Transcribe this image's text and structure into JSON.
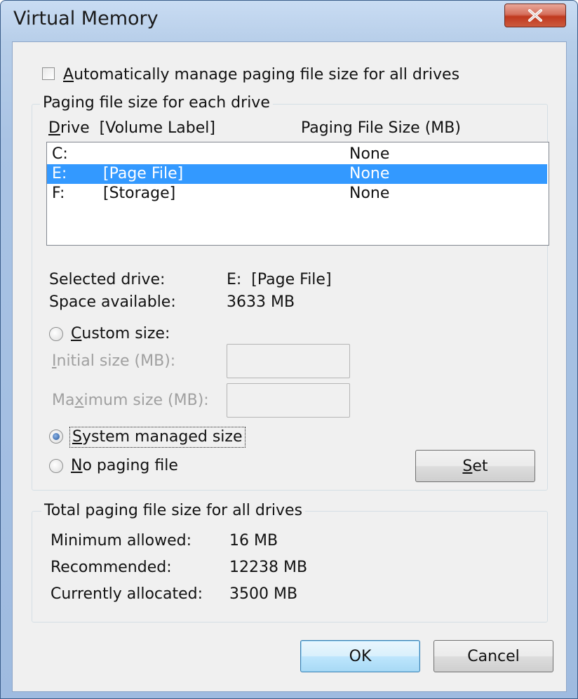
{
  "window": {
    "title": "Virtual Memory"
  },
  "auto_manage": {
    "label_pre": "",
    "label_mnemonic": "A",
    "label_post": "utomatically manage paging file size for all drives",
    "checked": false
  },
  "paging_group": {
    "label": "Paging file size for each drive",
    "col_drive_mnemonic": "D",
    "col_drive_rest": "rive  [Volume Label]",
    "col_size": "Paging File Size (MB)",
    "rows": [
      {
        "drive": "C:",
        "label": "",
        "size": "None",
        "selected": false
      },
      {
        "drive": "E:",
        "label": "[Page File]",
        "size": "None",
        "selected": true
      },
      {
        "drive": "F:",
        "label": "[Storage]",
        "size": "None",
        "selected": false
      }
    ],
    "selected_drive_label": "Selected drive:",
    "selected_drive_value": "E:  [Page File]",
    "space_available_label": "Space available:",
    "space_available_value": "3633 MB",
    "custom_size": {
      "mnemonic": "C",
      "rest": "ustom size:",
      "selected": false
    },
    "initial_size": {
      "mnemonic": "I",
      "rest": "nitial size (MB):",
      "value": ""
    },
    "maximum_size": {
      "pre": "Ma",
      "mnemonic": "x",
      "rest": "imum size (MB):",
      "value": ""
    },
    "system_managed": {
      "pre": "",
      "mnemonic": "S",
      "rest": "ystem managed size",
      "selected": true
    },
    "no_paging": {
      "mnemonic": "N",
      "rest": "o paging file",
      "selected": false
    },
    "set_button": {
      "mnemonic": "S",
      "rest": "et"
    }
  },
  "totals_group": {
    "label": "Total paging file size for all drives",
    "minimum_label": "Minimum allowed:",
    "minimum_value": "16 MB",
    "recommended_label": "Recommended:",
    "recommended_value": "12238 MB",
    "allocated_label": "Currently allocated:",
    "allocated_value": "3500 MB"
  },
  "footer": {
    "ok_label": "OK",
    "cancel_label": "Cancel"
  },
  "icons": {
    "close": "close-icon"
  }
}
